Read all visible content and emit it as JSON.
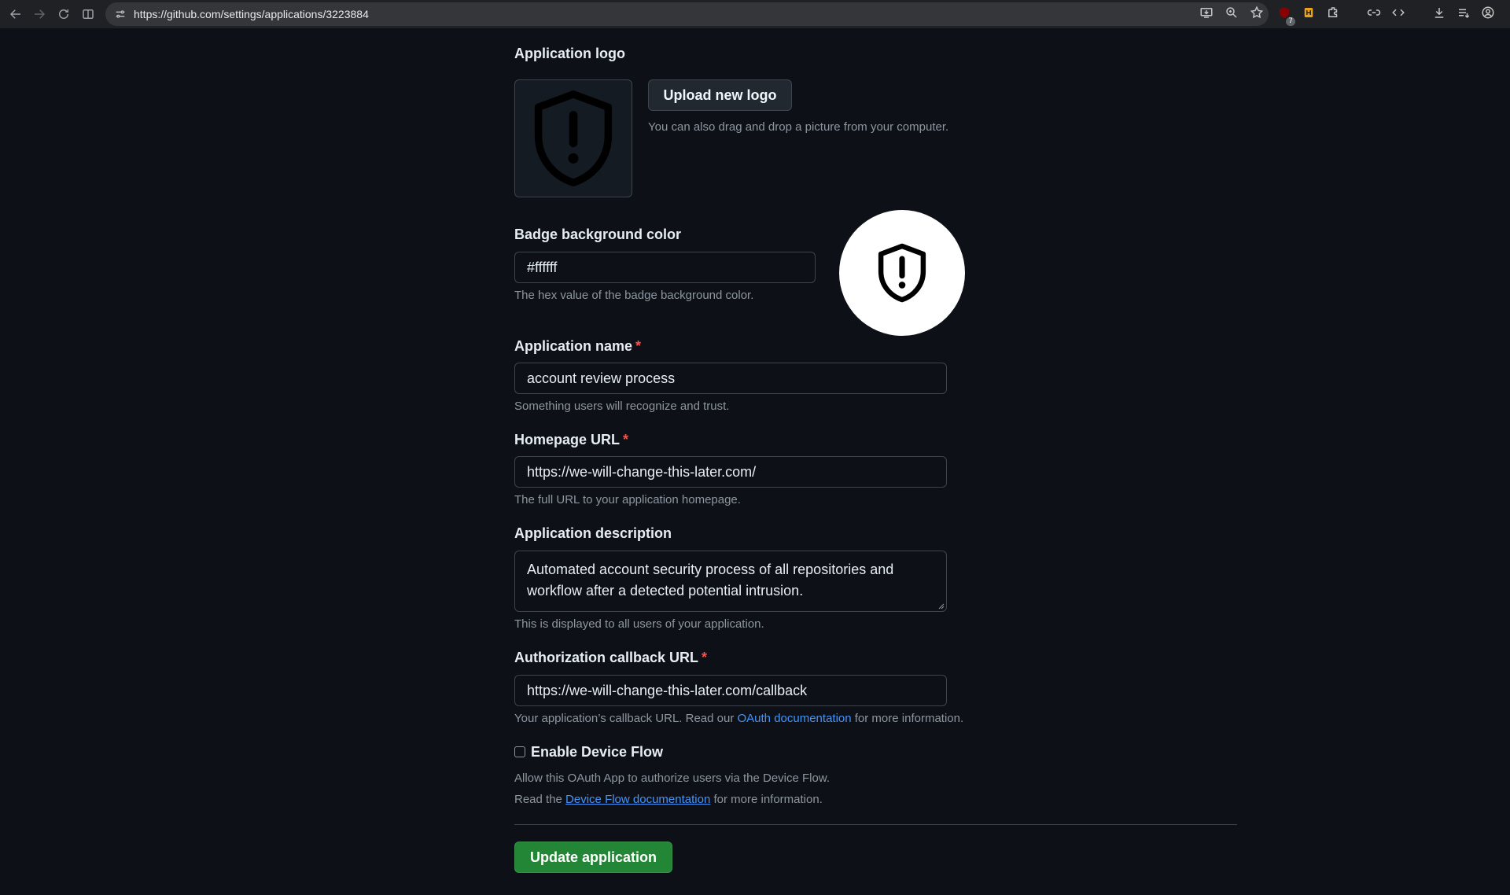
{
  "browser": {
    "url": "https://github.com/settings/applications/3223884",
    "extension_badge_count": "7"
  },
  "logo": {
    "label": "Application logo",
    "upload_button": "Upload new logo",
    "hint": "You can also drag and drop a picture from your computer.",
    "icon": "shield-exclamation-icon"
  },
  "badge": {
    "label": "Badge background color",
    "value": "#ffffff",
    "hint": "The hex value of the badge background color.",
    "preview_color": "#ffffff"
  },
  "app_name": {
    "label": "Application name",
    "required_mark": "*",
    "value": "account review process",
    "hint": "Something users will recognize and trust."
  },
  "homepage": {
    "label": "Homepage URL",
    "required_mark": "*",
    "value": "https://we-will-change-this-later.com/",
    "hint": "The full URL to your application homepage."
  },
  "description": {
    "label": "Application description",
    "line1": "Automated account security process of all repositories and",
    "line2": "workflow after a detected potential intrusion.",
    "hint": "This is displayed to all users of your application."
  },
  "callback": {
    "label": "Authorization callback URL",
    "required_mark": "*",
    "value": "https://we-will-change-this-later.com/callback",
    "hint_pre": "Your application’s callback URL. Read our ",
    "hint_link": "OAuth documentation",
    "hint_post": " for more information."
  },
  "device_flow": {
    "label": "Enable Device Flow",
    "checked": false,
    "hint1": "Allow this OAuth App to authorize users via the Device Flow.",
    "hint2_pre": "Read the ",
    "hint2_link": "Device Flow documentation",
    "hint2_post": " for more information."
  },
  "submit": {
    "label": "Update application",
    "color": "#238636"
  }
}
